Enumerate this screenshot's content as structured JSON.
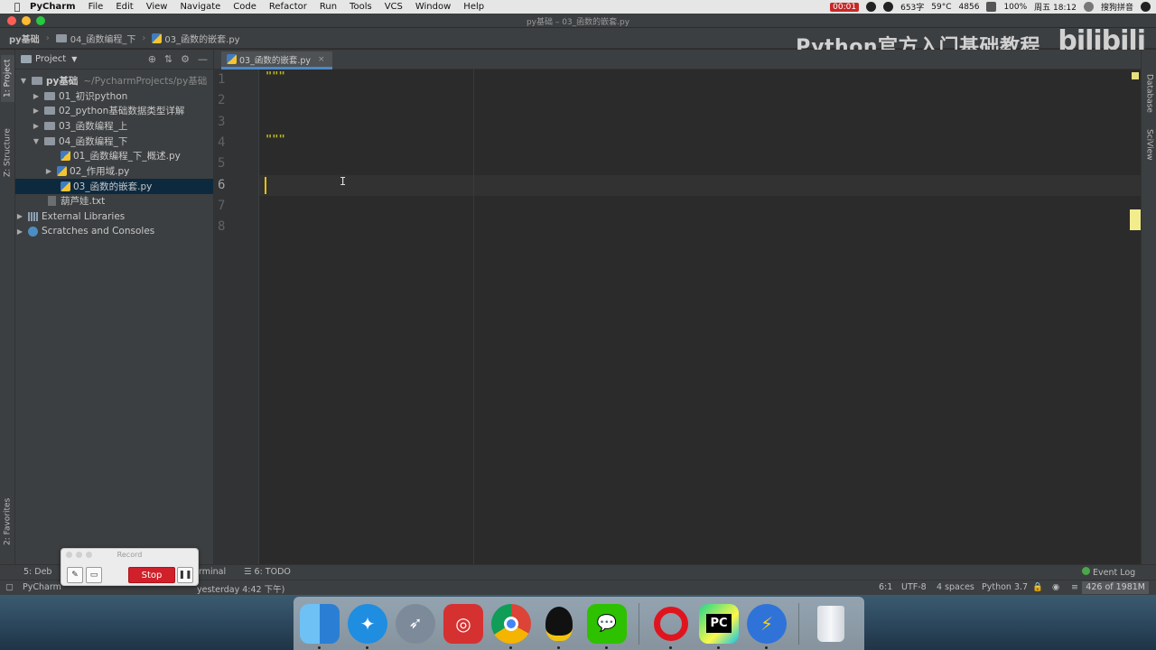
{
  "menubar": {
    "app_name": "PyCharm",
    "items": [
      "File",
      "Edit",
      "View",
      "Navigate",
      "Code",
      "Refactor",
      "Run",
      "Tools",
      "VCS",
      "Window",
      "Help"
    ],
    "rec_time": "00:01",
    "word_count": "653字",
    "temp": "59°C",
    "rpm": "4856",
    "battery": "100%",
    "clock": "周五 18:12",
    "input_method": "搜狗拼音"
  },
  "window": {
    "title": "py基础 – 03_函数的嵌套.py"
  },
  "navbar": {
    "crumbs": [
      "py基础",
      "04_函数编程_下",
      "03_函数的嵌套.py"
    ]
  },
  "watermark": {
    "text": "Python官方入门基础教程",
    "logo": "bilibili"
  },
  "left_stripe": {
    "project": "1: Project",
    "structure": "Z: Structure",
    "favorites": "2: Favorites"
  },
  "right_stripe": {
    "database": "Database",
    "sciview": "SciView"
  },
  "project_panel": {
    "title": "Project",
    "tree": {
      "root": {
        "name": "py基础",
        "path": "~/PycharmProjects/py基础"
      },
      "folders": [
        {
          "name": "01_初识python"
        },
        {
          "name": "02_python基础数据类型详解"
        },
        {
          "name": "03_函数编程_上"
        },
        {
          "name": "04_函数编程_下"
        }
      ],
      "files": [
        {
          "name": "01_函数编程_下_概述.py"
        },
        {
          "name": "02_作用域.py"
        },
        {
          "name": "03_函数的嵌套.py"
        }
      ],
      "txt_file": "葫芦娃.txt",
      "external": "External Libraries",
      "scratches": "Scratches and Consoles"
    }
  },
  "editor": {
    "tab_label": "03_函数的嵌套.py",
    "line_numbers": [
      "1",
      "2",
      "3",
      "4",
      "5",
      "6",
      "7",
      "8"
    ],
    "lines": [
      "\"\"\"",
      "",
      "",
      "\"\"\"",
      "",
      "",
      "",
      ""
    ],
    "ibeam": "I"
  },
  "bottom_tabs": {
    "debug": "5: Deb",
    "terminal": "Terminal",
    "todo": "6: TODO",
    "event_log": "Event Log"
  },
  "statusbar": {
    "left": "PyCharm",
    "left_tail": "yesterday 4:42 下午)",
    "position": "6:1",
    "encoding": "UTF-8",
    "indent": "4 spaces",
    "interpreter": "Python 3.7",
    "memory": "426 of 1981M"
  },
  "record_overlay": {
    "title": "Record",
    "stop_label": "Stop"
  },
  "dock": {
    "pc_label": "PC"
  }
}
